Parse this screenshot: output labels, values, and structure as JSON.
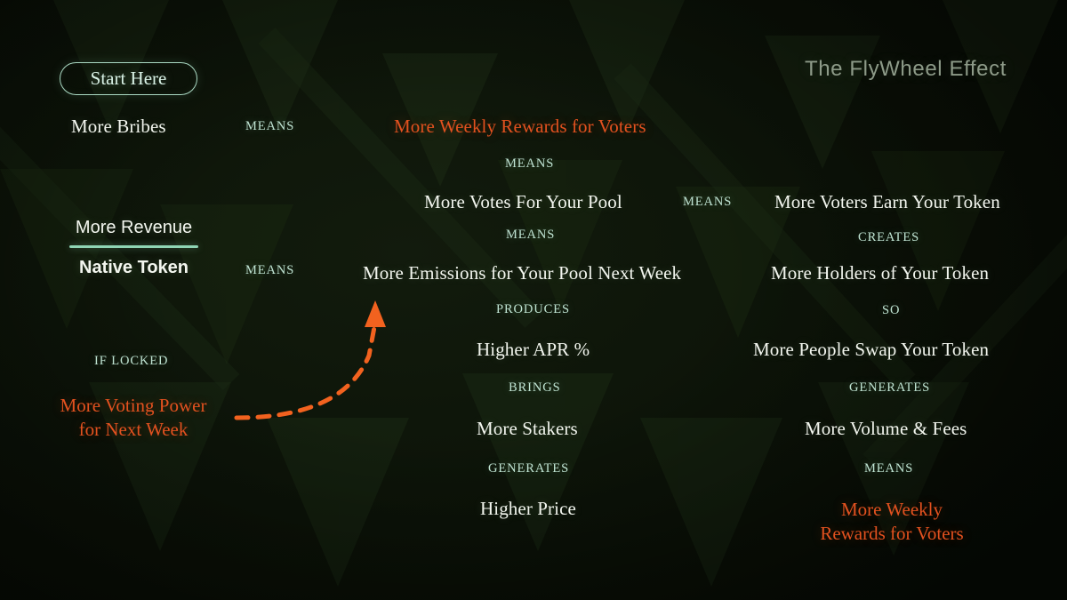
{
  "header": {
    "title": "The FlyWheel Effect",
    "start_button": "Start Here"
  },
  "colors": {
    "background": "#0b1207",
    "accent_orange": "#e2511f",
    "connector_green": "#bfe3d2",
    "node_text": "#f2f5ee",
    "title_gray": "#8d9a88",
    "fraction_bar": "#8fd4b4"
  },
  "left_column": {
    "bribes": "More Bribes",
    "fraction_numerator": "More Revenue",
    "fraction_denominator": "Native Token",
    "if_locked": "IF LOCKED",
    "voting_power_line1": "More Voting Power",
    "voting_power_line2": "for Next Week",
    "conn_bribes": "MEANS",
    "conn_revenue": "MEANS"
  },
  "middle_column": {
    "items": [
      {
        "label": "More Weekly Rewards for Voters",
        "accent": true
      },
      {
        "label": "More Votes For Your Pool",
        "accent": false
      },
      {
        "label": "More Emissions for Your Pool Next Week",
        "accent": false
      },
      {
        "label": "Higher APR %",
        "accent": false
      },
      {
        "label": "More Stakers",
        "accent": false
      },
      {
        "label": "Higher Price",
        "accent": false
      }
    ],
    "connectors": [
      "MEANS",
      "MEANS",
      "PRODUCES",
      "BRINGS",
      "GENERATES"
    ],
    "conn_to_right": "MEANS"
  },
  "right_column": {
    "items": [
      {
        "label": "More Voters Earn Your Token",
        "accent": false
      },
      {
        "label": "More Holders of Your Token",
        "accent": false
      },
      {
        "label": "More People Swap Your Token",
        "accent": false
      },
      {
        "label": "More Volume & Fees",
        "accent": false
      }
    ],
    "connectors": [
      "CREATES",
      "SO",
      "GENERATES",
      "MEANS"
    ],
    "final_line1": "More Weekly",
    "final_line2": "Rewards for Voters"
  }
}
